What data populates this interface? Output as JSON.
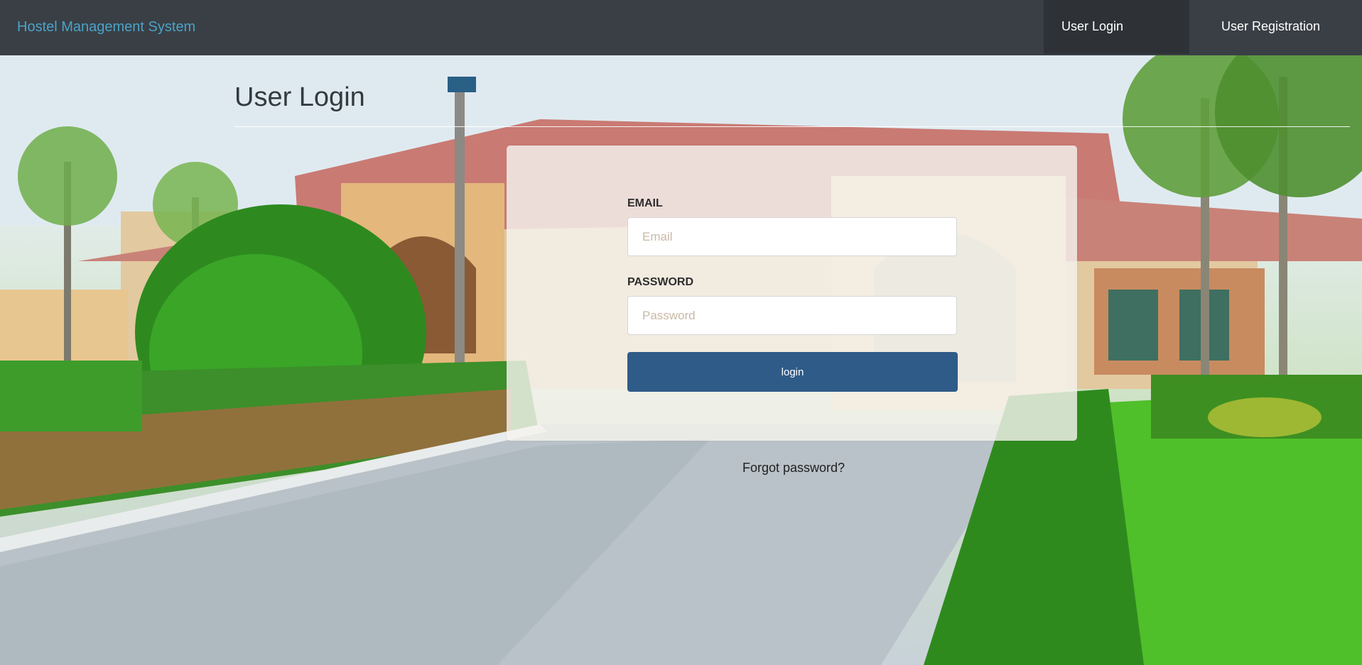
{
  "navbar": {
    "brand": "Hostel Management System",
    "links": [
      {
        "label": "User Login",
        "active": true
      },
      {
        "label": "User Registration",
        "active": false
      }
    ]
  },
  "page": {
    "title": "User Login"
  },
  "form": {
    "email_label": "EMAIL",
    "email_placeholder": "Email",
    "email_value": "",
    "password_label": "PASSWORD",
    "password_placeholder": "Password",
    "password_value": "",
    "submit_label": "login",
    "forgot_label": "Forgot password?"
  },
  "colors": {
    "navbar_bg": "#3a3f45",
    "brand": "#4aa3c9",
    "button": "#2f5b88"
  }
}
